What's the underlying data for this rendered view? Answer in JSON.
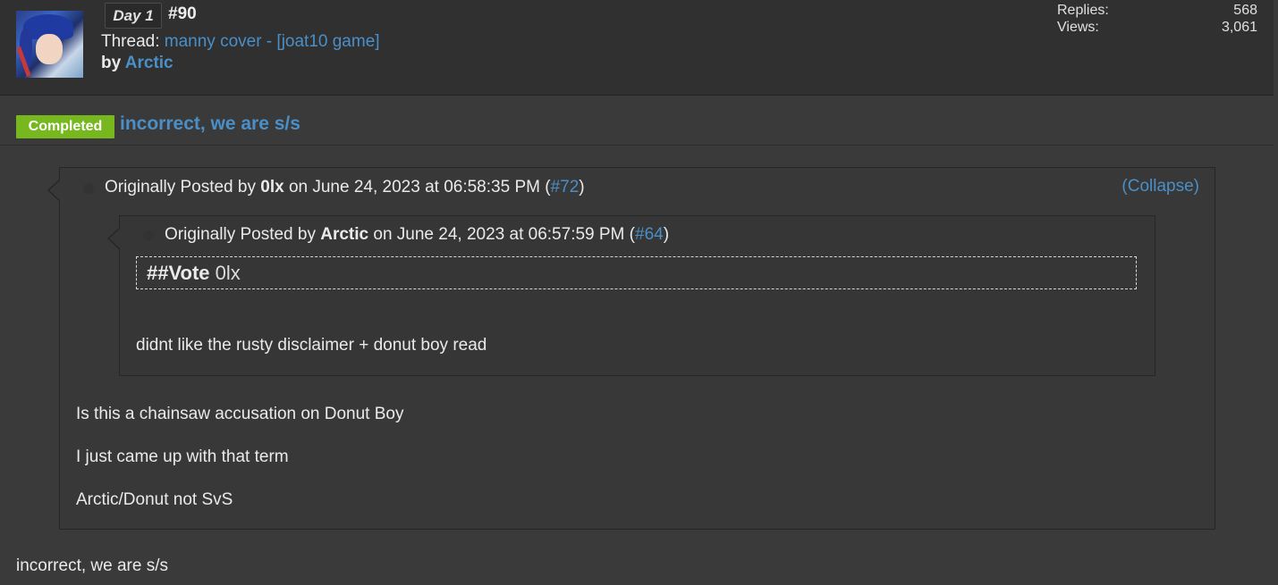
{
  "header": {
    "day_badge": "Day 1",
    "post_number": "#90",
    "thread_prefix": "Thread:",
    "thread_title": "manny cover - [joat10 game]",
    "by_prefix": "by",
    "author": "Arctic",
    "stats": {
      "replies_label": "Replies:",
      "replies_value": "568",
      "views_label": "Views:",
      "views_value": "3,061"
    }
  },
  "post": {
    "status_badge": "Completed",
    "title": "incorrect, we are s/s",
    "outer_quote": {
      "prefix": "Originally Posted by",
      "author": "0lx",
      "date_text": "on June 24, 2023 at 06:58:35 PM",
      "ref": "#72",
      "collapse": "(Collapse)",
      "lines": [
        "Is this a chainsaw accusation on Donut Boy",
        "I just came up with that term",
        "Arctic/Donut not SvS"
      ]
    },
    "inner_quote": {
      "prefix": "Originally Posted by",
      "author": "Arctic",
      "date_text": "on June 24, 2023 at 06:57:59 PM",
      "ref": "#64",
      "vote_label": "##Vote",
      "vote_target": "0lx",
      "text": "didnt like the rusty disclaimer + donut boy read"
    },
    "reply_text": "incorrect, we are s/s"
  }
}
